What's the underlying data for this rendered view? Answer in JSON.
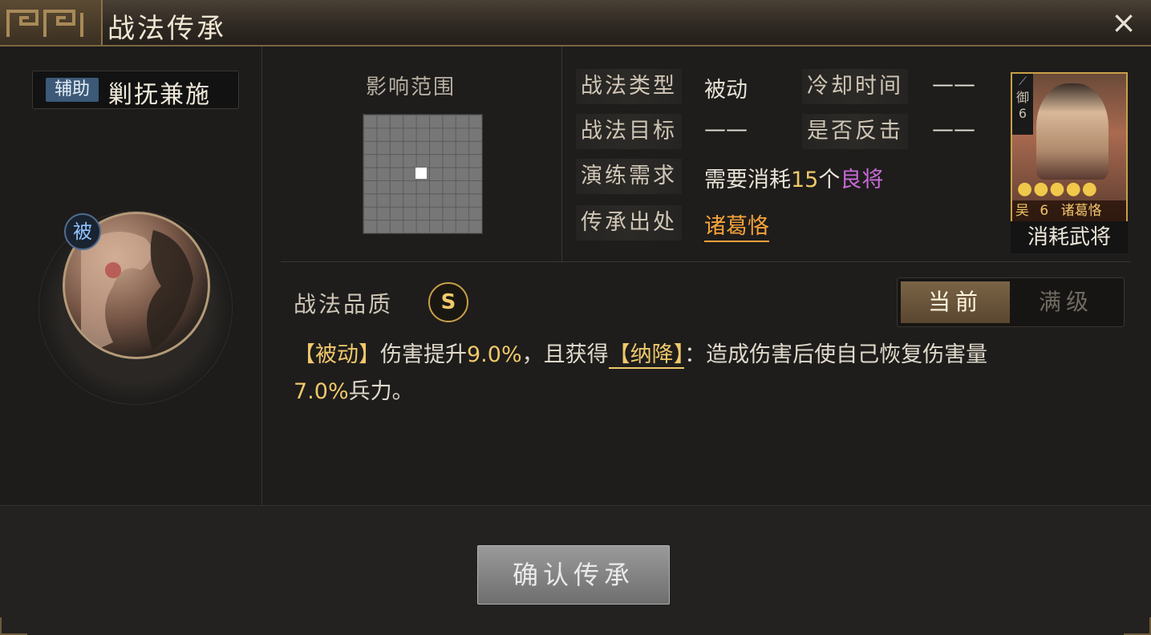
{
  "window": {
    "title": "战法传承",
    "close_icon": "×"
  },
  "skill": {
    "tag": "辅助",
    "name": "剿抚兼施",
    "passive_badge": "被"
  },
  "range": {
    "label": "影响范围"
  },
  "info": {
    "type_label": "战法类型",
    "type_value": "被动",
    "cooldown_label": "冷却时间",
    "cooldown_value": "——",
    "target_label": "战法目标",
    "target_value": "——",
    "counter_label": "是否反击",
    "counter_value": "——",
    "practice_label": "演练需求",
    "practice_prefix": "需要消耗",
    "practice_count": "15",
    "practice_unit": "个",
    "practice_item": "良将",
    "source_label": "传承出处",
    "source_value": "诸葛恪"
  },
  "general_card": {
    "unit": "御",
    "unit_level": "6",
    "stars": "●●●●●",
    "faction": "吴",
    "cost": "6",
    "name": "诸葛恪",
    "caption": "消耗武将"
  },
  "quality": {
    "label": "战法品质",
    "grade": "S"
  },
  "level_toggle": {
    "current": "当前",
    "max": "满级",
    "selected": "当前"
  },
  "description": {
    "tag1": "【被动】",
    "text1": "伤害提升",
    "num1": "9.0%",
    "text2": "，且获得",
    "tag2": "【纳降】",
    "text3": "：造成伤害后使自己恢复伤害量",
    "num2": "7.0%",
    "text4": "兵力。"
  },
  "actions": {
    "confirm": "确认传承"
  },
  "colors": {
    "gold": "#f0c86a",
    "purple": "#c86ad6",
    "orange": "#f5a23a",
    "frame": "#c9a047"
  }
}
